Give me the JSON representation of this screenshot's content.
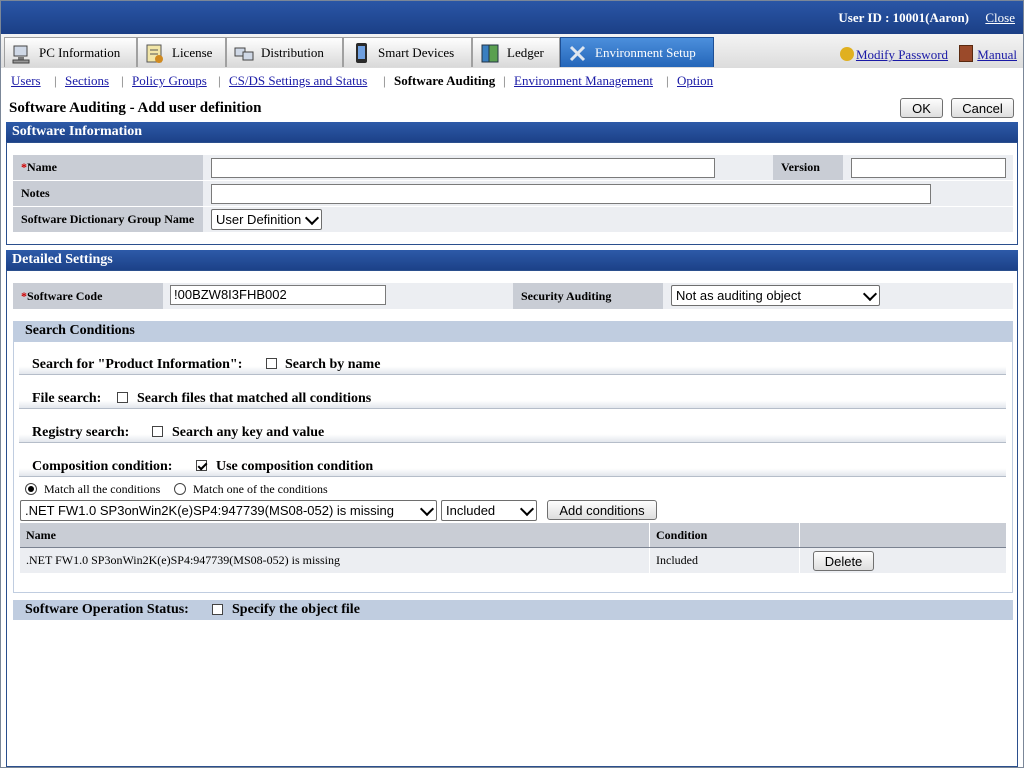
{
  "header": {
    "user_label": "User ID : 10001(Aaron)",
    "close": "Close"
  },
  "tabs": [
    {
      "label": "PC Information",
      "icon": "pc-icon"
    },
    {
      "label": "License",
      "icon": "license-icon"
    },
    {
      "label": "Distribution",
      "icon": "distribution-icon"
    },
    {
      "label": "Smart Devices",
      "icon": "smartphone-icon"
    },
    {
      "label": "Ledger",
      "icon": "ledger-icon"
    },
    {
      "label": "Environment Setup",
      "icon": "tools-icon",
      "active": true
    }
  ],
  "links": {
    "modify_password": "Modify Password",
    "manual": "Manual"
  },
  "subnav": [
    "Users",
    "Sections",
    "Policy Groups",
    "CS/DS Settings and Status",
    "Software Auditing",
    "Environment Management",
    "Option"
  ],
  "page": {
    "title": "Software Auditing - Add user definition",
    "ok": "OK",
    "cancel": "Cancel"
  },
  "software_info": {
    "heading": "Software Information",
    "name_label": "Name",
    "name_value": "",
    "version_label": "Version",
    "version_value": "",
    "notes_label": "Notes",
    "notes_value": "",
    "group_label": "Software Dictionary Group Name",
    "group_value": "User Definition",
    "required_mark": "*"
  },
  "detailed": {
    "heading": "Detailed Settings",
    "code_label": "Software Code",
    "code_value": "!00BZW8I3FHB002",
    "security_label": "Security Auditing",
    "security_value": "Not as auditing object"
  },
  "search": {
    "heading": "Search Conditions",
    "product_label": "Search for \"Product Information\":",
    "product_check": "Search by name",
    "product_checked": false,
    "file_label": "File search:",
    "file_check": "Search files that matched all conditions",
    "file_checked": false,
    "registry_label": "Registry search:",
    "registry_check": "Search any key and value",
    "registry_checked": false,
    "composition_label": "Composition condition:",
    "composition_check": "Use composition condition",
    "composition_checked": true,
    "match_all": "Match all the conditions",
    "match_one": "Match one of the conditions",
    "match_selected": "all",
    "condition_select": ".NET FW1.0 SP3onWin2K(e)SP4:947739(MS08-052) is missing",
    "included_select": "Included",
    "add_button": "Add conditions",
    "table": {
      "headers": [
        "Name",
        "Condition",
        ""
      ],
      "rows": [
        {
          "name": ".NET FW1.0 SP3onWin2K(e)SP4:947739(MS08-052) is missing",
          "condition": "Included",
          "action": "Delete"
        }
      ]
    }
  },
  "operation": {
    "label": "Software Operation Status:",
    "check": "Specify the object file",
    "checked": false
  },
  "colors": {
    "header_blue": "#1c4188",
    "tab_active": "#2466b9",
    "label_bg": "#c9cdd5",
    "search_head": "#c0cde0",
    "link": "#1a1aa6",
    "required": "#d00000"
  }
}
